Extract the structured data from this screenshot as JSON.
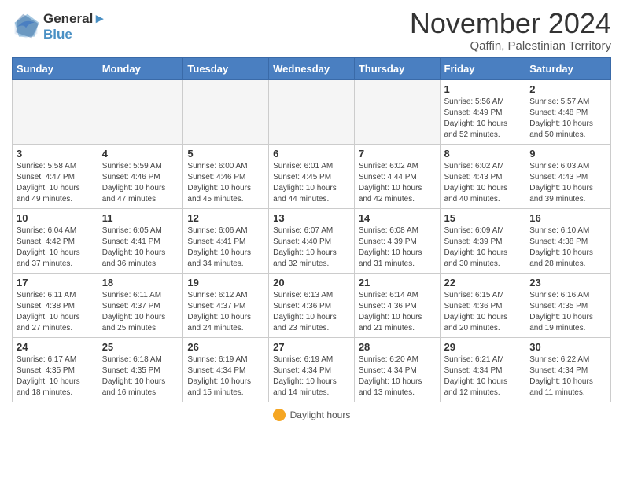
{
  "header": {
    "logo_line1": "General",
    "logo_line2": "Blue",
    "month_title": "November 2024",
    "subtitle": "Qaffin, Palestinian Territory"
  },
  "weekdays": [
    "Sunday",
    "Monday",
    "Tuesday",
    "Wednesday",
    "Thursday",
    "Friday",
    "Saturday"
  ],
  "footer": {
    "label": "Daylight hours"
  },
  "weeks": [
    [
      {
        "day": "",
        "info": ""
      },
      {
        "day": "",
        "info": ""
      },
      {
        "day": "",
        "info": ""
      },
      {
        "day": "",
        "info": ""
      },
      {
        "day": "",
        "info": ""
      },
      {
        "day": "1",
        "info": "Sunrise: 5:56 AM\nSunset: 4:49 PM\nDaylight: 10 hours\nand 52 minutes."
      },
      {
        "day": "2",
        "info": "Sunrise: 5:57 AM\nSunset: 4:48 PM\nDaylight: 10 hours\nand 50 minutes."
      }
    ],
    [
      {
        "day": "3",
        "info": "Sunrise: 5:58 AM\nSunset: 4:47 PM\nDaylight: 10 hours\nand 49 minutes."
      },
      {
        "day": "4",
        "info": "Sunrise: 5:59 AM\nSunset: 4:46 PM\nDaylight: 10 hours\nand 47 minutes."
      },
      {
        "day": "5",
        "info": "Sunrise: 6:00 AM\nSunset: 4:46 PM\nDaylight: 10 hours\nand 45 minutes."
      },
      {
        "day": "6",
        "info": "Sunrise: 6:01 AM\nSunset: 4:45 PM\nDaylight: 10 hours\nand 44 minutes."
      },
      {
        "day": "7",
        "info": "Sunrise: 6:02 AM\nSunset: 4:44 PM\nDaylight: 10 hours\nand 42 minutes."
      },
      {
        "day": "8",
        "info": "Sunrise: 6:02 AM\nSunset: 4:43 PM\nDaylight: 10 hours\nand 40 minutes."
      },
      {
        "day": "9",
        "info": "Sunrise: 6:03 AM\nSunset: 4:43 PM\nDaylight: 10 hours\nand 39 minutes."
      }
    ],
    [
      {
        "day": "10",
        "info": "Sunrise: 6:04 AM\nSunset: 4:42 PM\nDaylight: 10 hours\nand 37 minutes."
      },
      {
        "day": "11",
        "info": "Sunrise: 6:05 AM\nSunset: 4:41 PM\nDaylight: 10 hours\nand 36 minutes."
      },
      {
        "day": "12",
        "info": "Sunrise: 6:06 AM\nSunset: 4:41 PM\nDaylight: 10 hours\nand 34 minutes."
      },
      {
        "day": "13",
        "info": "Sunrise: 6:07 AM\nSunset: 4:40 PM\nDaylight: 10 hours\nand 32 minutes."
      },
      {
        "day": "14",
        "info": "Sunrise: 6:08 AM\nSunset: 4:39 PM\nDaylight: 10 hours\nand 31 minutes."
      },
      {
        "day": "15",
        "info": "Sunrise: 6:09 AM\nSunset: 4:39 PM\nDaylight: 10 hours\nand 30 minutes."
      },
      {
        "day": "16",
        "info": "Sunrise: 6:10 AM\nSunset: 4:38 PM\nDaylight: 10 hours\nand 28 minutes."
      }
    ],
    [
      {
        "day": "17",
        "info": "Sunrise: 6:11 AM\nSunset: 4:38 PM\nDaylight: 10 hours\nand 27 minutes."
      },
      {
        "day": "18",
        "info": "Sunrise: 6:11 AM\nSunset: 4:37 PM\nDaylight: 10 hours\nand 25 minutes."
      },
      {
        "day": "19",
        "info": "Sunrise: 6:12 AM\nSunset: 4:37 PM\nDaylight: 10 hours\nand 24 minutes."
      },
      {
        "day": "20",
        "info": "Sunrise: 6:13 AM\nSunset: 4:36 PM\nDaylight: 10 hours\nand 23 minutes."
      },
      {
        "day": "21",
        "info": "Sunrise: 6:14 AM\nSunset: 4:36 PM\nDaylight: 10 hours\nand 21 minutes."
      },
      {
        "day": "22",
        "info": "Sunrise: 6:15 AM\nSunset: 4:36 PM\nDaylight: 10 hours\nand 20 minutes."
      },
      {
        "day": "23",
        "info": "Sunrise: 6:16 AM\nSunset: 4:35 PM\nDaylight: 10 hours\nand 19 minutes."
      }
    ],
    [
      {
        "day": "24",
        "info": "Sunrise: 6:17 AM\nSunset: 4:35 PM\nDaylight: 10 hours\nand 18 minutes."
      },
      {
        "day": "25",
        "info": "Sunrise: 6:18 AM\nSunset: 4:35 PM\nDaylight: 10 hours\nand 16 minutes."
      },
      {
        "day": "26",
        "info": "Sunrise: 6:19 AM\nSunset: 4:34 PM\nDaylight: 10 hours\nand 15 minutes."
      },
      {
        "day": "27",
        "info": "Sunrise: 6:19 AM\nSunset: 4:34 PM\nDaylight: 10 hours\nand 14 minutes."
      },
      {
        "day": "28",
        "info": "Sunrise: 6:20 AM\nSunset: 4:34 PM\nDaylight: 10 hours\nand 13 minutes."
      },
      {
        "day": "29",
        "info": "Sunrise: 6:21 AM\nSunset: 4:34 PM\nDaylight: 10 hours\nand 12 minutes."
      },
      {
        "day": "30",
        "info": "Sunrise: 6:22 AM\nSunset: 4:34 PM\nDaylight: 10 hours\nand 11 minutes."
      }
    ]
  ]
}
